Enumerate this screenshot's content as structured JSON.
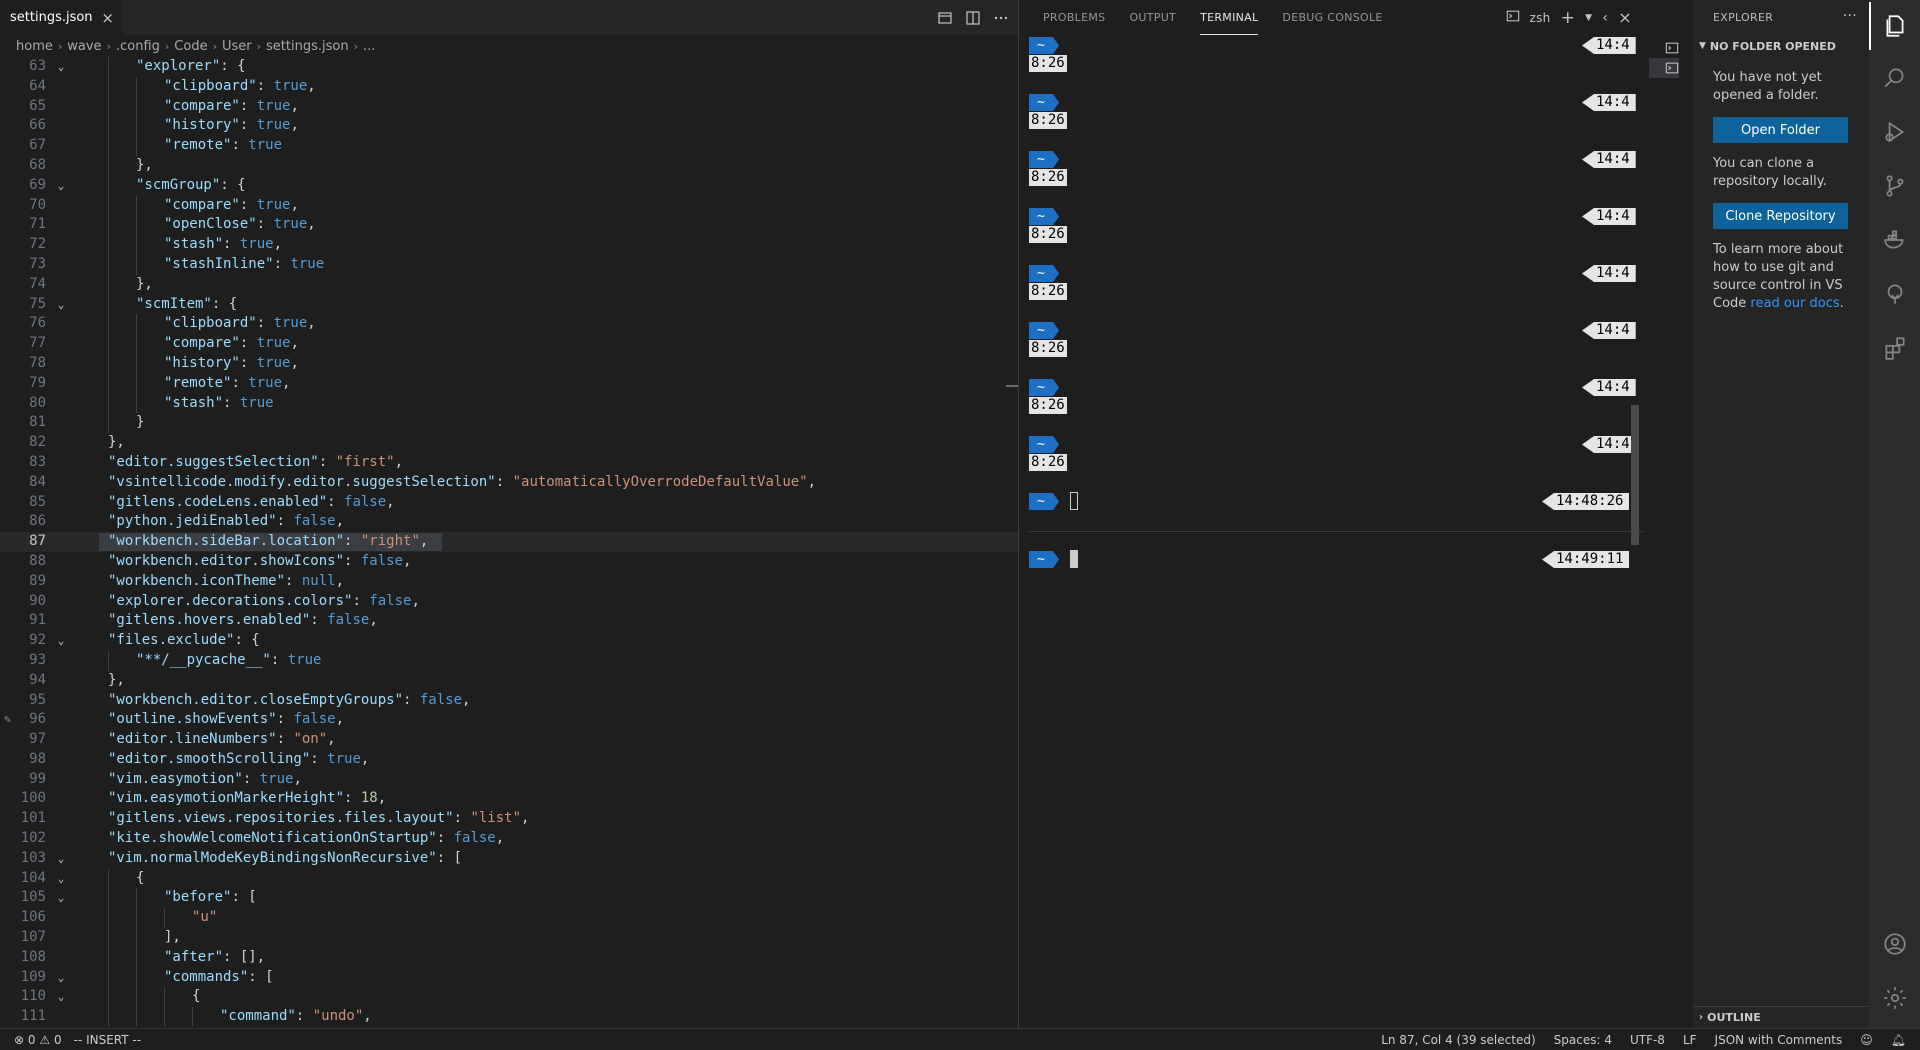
{
  "editor": {
    "tab": {
      "label": "settings.json",
      "close": "×"
    },
    "breadcrumb": [
      "home",
      "wave",
      ".config",
      "Code",
      "User",
      "settings.json",
      "..."
    ],
    "lines": [
      {
        "n": "63",
        "fold": true,
        "ind": 1,
        "t": [
          [
            "k",
            "\"explorer\""
          ],
          [
            "p",
            ": {"
          ]
        ]
      },
      {
        "n": "64",
        "ind": 2,
        "t": [
          [
            "k",
            "\"clipboard\""
          ],
          [
            "p",
            ": "
          ],
          [
            "b",
            "true"
          ],
          [
            "p",
            ","
          ]
        ]
      },
      {
        "n": "65",
        "ind": 2,
        "t": [
          [
            "k",
            "\"compare\""
          ],
          [
            "p",
            ": "
          ],
          [
            "b",
            "true"
          ],
          [
            "p",
            ","
          ]
        ]
      },
      {
        "n": "66",
        "ind": 2,
        "t": [
          [
            "k",
            "\"history\""
          ],
          [
            "p",
            ": "
          ],
          [
            "b",
            "true"
          ],
          [
            "p",
            ","
          ]
        ]
      },
      {
        "n": "67",
        "ind": 2,
        "t": [
          [
            "k",
            "\"remote\""
          ],
          [
            "p",
            ": "
          ],
          [
            "b",
            "true"
          ]
        ]
      },
      {
        "n": "68",
        "ind": 1,
        "t": [
          [
            "p",
            "},"
          ]
        ]
      },
      {
        "n": "69",
        "fold": true,
        "ind": 1,
        "t": [
          [
            "k",
            "\"scmGroup\""
          ],
          [
            "p",
            ": {"
          ]
        ]
      },
      {
        "n": "70",
        "ind": 2,
        "t": [
          [
            "k",
            "\"compare\""
          ],
          [
            "p",
            ": "
          ],
          [
            "b",
            "true"
          ],
          [
            "p",
            ","
          ]
        ]
      },
      {
        "n": "71",
        "ind": 2,
        "t": [
          [
            "k",
            "\"openClose\""
          ],
          [
            "p",
            ": "
          ],
          [
            "b",
            "true"
          ],
          [
            "p",
            ","
          ]
        ]
      },
      {
        "n": "72",
        "ind": 2,
        "t": [
          [
            "k",
            "\"stash\""
          ],
          [
            "p",
            ": "
          ],
          [
            "b",
            "true"
          ],
          [
            "p",
            ","
          ]
        ]
      },
      {
        "n": "73",
        "ind": 2,
        "t": [
          [
            "k",
            "\"stashInline\""
          ],
          [
            "p",
            ": "
          ],
          [
            "b",
            "true"
          ]
        ]
      },
      {
        "n": "74",
        "ind": 1,
        "t": [
          [
            "p",
            "},"
          ]
        ]
      },
      {
        "n": "75",
        "fold": true,
        "ind": 1,
        "t": [
          [
            "k",
            "\"scmItem\""
          ],
          [
            "p",
            ": {"
          ]
        ]
      },
      {
        "n": "76",
        "ind": 2,
        "t": [
          [
            "k",
            "\"clipboard\""
          ],
          [
            "p",
            ": "
          ],
          [
            "b",
            "true"
          ],
          [
            "p",
            ","
          ]
        ]
      },
      {
        "n": "77",
        "ind": 2,
        "t": [
          [
            "k",
            "\"compare\""
          ],
          [
            "p",
            ": "
          ],
          [
            "b",
            "true"
          ],
          [
            "p",
            ","
          ]
        ]
      },
      {
        "n": "78",
        "ind": 2,
        "t": [
          [
            "k",
            "\"history\""
          ],
          [
            "p",
            ": "
          ],
          [
            "b",
            "true"
          ],
          [
            "p",
            ","
          ]
        ]
      },
      {
        "n": "79",
        "ind": 2,
        "t": [
          [
            "k",
            "\"remote\""
          ],
          [
            "p",
            ": "
          ],
          [
            "b",
            "true"
          ],
          [
            "p",
            ","
          ]
        ]
      },
      {
        "n": "80",
        "ind": 2,
        "t": [
          [
            "k",
            "\"stash\""
          ],
          [
            "p",
            ": "
          ],
          [
            "b",
            "true"
          ]
        ]
      },
      {
        "n": "81",
        "ind": 1,
        "t": [
          [
            "p",
            "}"
          ]
        ]
      },
      {
        "n": "82",
        "ind": 0,
        "t": [
          [
            "p",
            "},"
          ]
        ]
      },
      {
        "n": "83",
        "ind": 0,
        "t": [
          [
            "k",
            "\"editor.suggestSelection\""
          ],
          [
            "p",
            ": "
          ],
          [
            "s",
            "\"first\""
          ],
          [
            "p",
            ","
          ]
        ]
      },
      {
        "n": "84",
        "ind": 0,
        "t": [
          [
            "k",
            "\"vsintellicode.modify.editor.suggestSelection\""
          ],
          [
            "p",
            ": "
          ],
          [
            "s",
            "\"automaticallyOverrodeDefaultValue\""
          ],
          [
            "p",
            ","
          ]
        ]
      },
      {
        "n": "85",
        "ind": 0,
        "t": [
          [
            "k",
            "\"gitlens.codeLens.enabled\""
          ],
          [
            "p",
            ": "
          ],
          [
            "b",
            "false"
          ],
          [
            "p",
            ","
          ]
        ]
      },
      {
        "n": "86",
        "ind": 0,
        "t": [
          [
            "k",
            "\"python.jediEnabled\""
          ],
          [
            "p",
            ": "
          ],
          [
            "b",
            "false"
          ],
          [
            "p",
            ","
          ]
        ]
      },
      {
        "n": "87",
        "ind": 0,
        "current": true,
        "t": [
          [
            "k",
            "\"workbench.sideBar.location\""
          ],
          [
            "p",
            ": "
          ],
          [
            "s",
            "\"right\""
          ],
          [
            "p",
            ","
          ]
        ]
      },
      {
        "n": "88",
        "ind": 0,
        "t": [
          [
            "k",
            "\"workbench.editor.showIcons\""
          ],
          [
            "p",
            ": "
          ],
          [
            "b",
            "false"
          ],
          [
            "p",
            ","
          ]
        ]
      },
      {
        "n": "89",
        "ind": 0,
        "t": [
          [
            "k",
            "\"workbench.iconTheme\""
          ],
          [
            "p",
            ": "
          ],
          [
            "b",
            "null"
          ],
          [
            "p",
            ","
          ]
        ]
      },
      {
        "n": "90",
        "ind": 0,
        "t": [
          [
            "k",
            "\"explorer.decorations.colors\""
          ],
          [
            "p",
            ": "
          ],
          [
            "b",
            "false"
          ],
          [
            "p",
            ","
          ]
        ]
      },
      {
        "n": "91",
        "ind": 0,
        "t": [
          [
            "k",
            "\"gitlens.hovers.enabled\""
          ],
          [
            "p",
            ": "
          ],
          [
            "b",
            "false"
          ],
          [
            "p",
            ","
          ]
        ]
      },
      {
        "n": "92",
        "fold": true,
        "ind": 0,
        "t": [
          [
            "k",
            "\"files.exclude\""
          ],
          [
            "p",
            ": {"
          ]
        ]
      },
      {
        "n": "93",
        "ind": 1,
        "t": [
          [
            "k",
            "\"**/__pycache__\""
          ],
          [
            "p",
            ": "
          ],
          [
            "b",
            "true"
          ]
        ]
      },
      {
        "n": "94",
        "ind": 0,
        "t": [
          [
            "p",
            "},"
          ]
        ]
      },
      {
        "n": "95",
        "ind": 0,
        "t": [
          [
            "k",
            "\"workbench.editor.closeEmptyGroups\""
          ],
          [
            "p",
            ": "
          ],
          [
            "b",
            "false"
          ],
          [
            "p",
            ","
          ]
        ]
      },
      {
        "n": "96",
        "ind": 0,
        "edit": true,
        "t": [
          [
            "k",
            "\"outline.showEvents\""
          ],
          [
            "p",
            ": "
          ],
          [
            "b",
            "false"
          ],
          [
            "p",
            ","
          ]
        ]
      },
      {
        "n": "97",
        "ind": 0,
        "t": [
          [
            "k",
            "\"editor.lineNumbers\""
          ],
          [
            "p",
            ": "
          ],
          [
            "s",
            "\"on\""
          ],
          [
            "p",
            ","
          ]
        ]
      },
      {
        "n": "98",
        "ind": 0,
        "t": [
          [
            "k",
            "\"editor.smoothScrolling\""
          ],
          [
            "p",
            ": "
          ],
          [
            "b",
            "true"
          ],
          [
            "p",
            ","
          ]
        ]
      },
      {
        "n": "99",
        "ind": 0,
        "t": [
          [
            "k",
            "\"vim.easymotion\""
          ],
          [
            "p",
            ": "
          ],
          [
            "b",
            "true"
          ],
          [
            "p",
            ","
          ]
        ]
      },
      {
        "n": "100",
        "ind": 0,
        "t": [
          [
            "k",
            "\"vim.easymotionMarkerHeight\""
          ],
          [
            "p",
            ": "
          ],
          [
            "n",
            "18"
          ],
          [
            "p",
            ","
          ]
        ]
      },
      {
        "n": "101",
        "ind": 0,
        "t": [
          [
            "k",
            "\"gitlens.views.repositories.files.layout\""
          ],
          [
            "p",
            ": "
          ],
          [
            "s",
            "\"list\""
          ],
          [
            "p",
            ","
          ]
        ]
      },
      {
        "n": "102",
        "ind": 0,
        "t": [
          [
            "k",
            "\"kite.showWelcomeNotificationOnStartup\""
          ],
          [
            "p",
            ": "
          ],
          [
            "b",
            "false"
          ],
          [
            "p",
            ","
          ]
        ]
      },
      {
        "n": "103",
        "fold": true,
        "ind": 0,
        "t": [
          [
            "k",
            "\"vim.normalModeKeyBindingsNonRecursive\""
          ],
          [
            "p",
            ": ["
          ]
        ]
      },
      {
        "n": "104",
        "fold": true,
        "ind": 1,
        "t": [
          [
            "p",
            "{"
          ]
        ]
      },
      {
        "n": "105",
        "fold": true,
        "ind": 2,
        "t": [
          [
            "k",
            "\"before\""
          ],
          [
            "p",
            ": ["
          ]
        ]
      },
      {
        "n": "106",
        "ind": 3,
        "t": [
          [
            "s",
            "\"u\""
          ]
        ]
      },
      {
        "n": "107",
        "ind": 2,
        "t": [
          [
            "p",
            "],"
          ]
        ]
      },
      {
        "n": "108",
        "ind": 2,
        "t": [
          [
            "k",
            "\"after\""
          ],
          [
            "p",
            ": [],"
          ]
        ]
      },
      {
        "n": "109",
        "fold": true,
        "ind": 2,
        "t": [
          [
            "k",
            "\"commands\""
          ],
          [
            "p",
            ": ["
          ]
        ]
      },
      {
        "n": "110",
        "fold": true,
        "ind": 3,
        "t": [
          [
            "p",
            "{"
          ]
        ]
      },
      {
        "n": "111",
        "ind": 4,
        "t": [
          [
            "k",
            "\"command\""
          ],
          [
            "p",
            ": "
          ],
          [
            "s",
            "\"undo\""
          ],
          [
            "p",
            ","
          ]
        ]
      }
    ]
  },
  "panel": {
    "tabs": [
      "PROBLEMS",
      "OUTPUT",
      "TERMINAL",
      "DEBUG CONSOLE"
    ],
    "active_tab": "TERMINAL",
    "shell": "zsh",
    "prompt_symbol": "~",
    "history_prompts": [
      {
        "left_time": "8:26",
        "right_time": "14:4"
      },
      {
        "left_time": "8:26",
        "right_time": "14:4"
      },
      {
        "left_time": "8:26",
        "right_time": "14:4"
      },
      {
        "left_time": "8:26",
        "right_time": "14:4"
      },
      {
        "left_time": "8:26",
        "right_time": "14:4"
      },
      {
        "left_time": "8:26",
        "right_time": "14:4"
      },
      {
        "left_time": "8:26",
        "right_time": "14:4"
      },
      {
        "left_time": "8:26",
        "right_time": "14:4"
      }
    ],
    "current_prompt_top": {
      "right_time": "14:48:26"
    },
    "current_prompt_bottom": {
      "right_time": "14:49:11"
    }
  },
  "sidebar": {
    "title": "EXPLORER",
    "more": "···",
    "section": "NO FOLDER OPENED",
    "msg1": "You have not yet opened a folder.",
    "open_folder": "Open Folder",
    "msg2": "You can clone a repository locally.",
    "clone_repo": "Clone Repository",
    "msg3_pre": "To learn more about how to use git and source control in VS Code ",
    "msg3_link": "read our docs",
    "msg3_post": ".",
    "outline": "OUTLINE"
  },
  "statusbar": {
    "errors": "0",
    "warnings": "0",
    "mode": "-- INSERT --",
    "position": "Ln 87, Col 4 (39 selected)",
    "spaces": "Spaces: 4",
    "encoding": "UTF-8",
    "eol": "LF",
    "language": "JSON with Comments"
  }
}
